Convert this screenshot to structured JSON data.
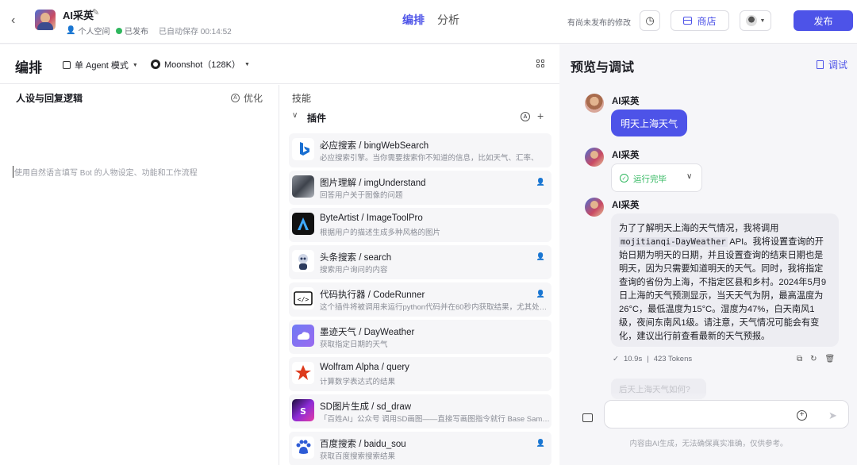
{
  "header": {
    "bot_name": "AI采英",
    "space": "个人空间",
    "publish_status": "已发布",
    "autosave": "已自动保存 00:14:52",
    "tabs": [
      "编排",
      "分析"
    ],
    "unpublished_note": "有尚未发布的修改",
    "store_label": "商店",
    "publish_label": "发布"
  },
  "editor": {
    "title": "编排",
    "mode": "单 Agent 模式",
    "model": "Moonshot（128K）",
    "persona_title": "人设与回复逻辑",
    "optimize_label": "优化",
    "persona_placeholder": "使用自然语言填写 Bot 的人物设定、功能和工作流程",
    "skills_title": "技能",
    "plugins_label": "插件",
    "plugins": [
      {
        "name": "必应搜索 / bingWebSearch",
        "desc": "必应搜索引擎。当你需要搜索你不知道的信息，比如天气、汇率、",
        "icon": "bing-icon",
        "personal": false
      },
      {
        "name": "图片理解 / imgUnderstand",
        "desc": "回答用户关于图像的问题",
        "icon": "image-understand-icon",
        "personal": true
      },
      {
        "name": "ByteArtist / ImageToolPro",
        "desc": "根据用户的描述生成多种风格的图片",
        "icon": "byteartist-icon",
        "personal": false
      },
      {
        "name": "头条搜索 / search",
        "desc": "搜索用户询问的内容",
        "icon": "toutiao-robot-icon",
        "personal": true
      },
      {
        "name": "代码执行器 / CodeRunner",
        "desc": "这个插件将被调用来运行python代码并在60秒内获取结果，尤其处…",
        "icon": "code-icon",
        "personal": true
      },
      {
        "name": "墨迹天气 / DayWeather",
        "desc": "获取指定日期的天气",
        "icon": "weather-icon",
        "personal": false
      },
      {
        "name": "Wolfram Alpha / query",
        "desc": "计算数学表达式的结果",
        "icon": "wolfram-icon",
        "personal": false
      },
      {
        "name": "SD图片生成 / sd_draw",
        "desc": "「百姓AI」公众号 调用SD画图——直接写画图指令就行 Base Sam…",
        "icon": "sd-draw-icon",
        "personal": false
      },
      {
        "name": "百度搜索 / baidu_sou",
        "desc": "获取百度搜索搜索结果",
        "icon": "baidu-icon",
        "personal": true
      }
    ]
  },
  "preview": {
    "title": "预览与调试",
    "debug_label": "调试",
    "sender_name": "AI采英",
    "user_message": "明天上海天气",
    "run_status": "运行完毕",
    "answer_part1": "为了了解明天上海的天气情况，我将调用",
    "answer_code": "mojitianqi-DayWeather",
    "answer_part2": " API。我将设置查询的开始日期为明天的日期，并且设置查询的结束日期也是明天，因为只需要知道明天的天气。同时，我将指定查询的省份为上海，不指定区县和乡村。2024年5月9日上海的天气预测显示，当天天气为阴，最高温度为26°C，最低温度为15°C。湿度为47%，白天南风1级，夜间东南风1级。请注意，天气情况可能会有变化，建议出行前查看最新的天气预报。",
    "duration": "10.9s",
    "tokens": "423 Tokens",
    "suggestion": "后天上海天气如何?",
    "disclaimer": "内容由AI生成，无法确保真实准确，仅供参考。"
  },
  "colors": {
    "accent": "#4d53e8",
    "success": "#2fb75e"
  }
}
